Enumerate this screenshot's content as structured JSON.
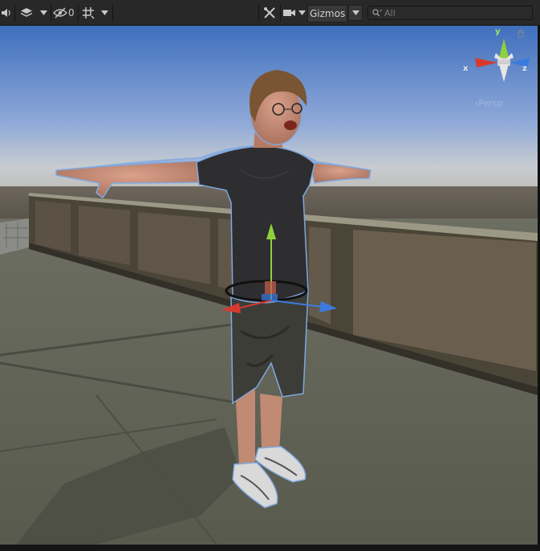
{
  "toolbar": {
    "audio_icon": "speaker-icon",
    "effects_icon": "layers-icon",
    "hidden_count": "0",
    "grid_icon": "grid-snap-icon",
    "tools_icon": "tools-icon",
    "camera_icon": "camera-icon",
    "gizmos_label": "Gizmos",
    "search_placeholder": "All"
  },
  "scene_gizmo": {
    "x_label": "x",
    "y_label": "y",
    "z_label": "z",
    "projection_label": "Persp"
  },
  "colors": {
    "toolbar_bg": "#282828",
    "x_axis": "#d63a2f",
    "y_axis": "#8fd13b",
    "z_axis": "#3b7be0"
  }
}
